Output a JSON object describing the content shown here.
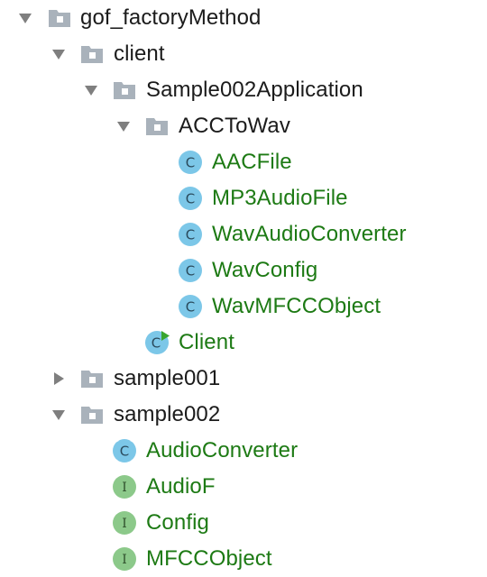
{
  "colors": {
    "folder_text": "#1b1b1b",
    "class_text": "#1d7a14",
    "class_icon": "#7cc7e8",
    "interface_icon": "#8cc98a",
    "folder_icon": "#a9b2bb",
    "arrow": "#7f7f7f",
    "run_badge": "#38a52f"
  },
  "tree": {
    "root": {
      "label": "gof_factoryMethod",
      "icon": "folder-icon",
      "expanded": true
    },
    "client": {
      "label": "client",
      "icon": "folder-icon",
      "expanded": true
    },
    "sample002_application": {
      "label": "Sample002Application",
      "icon": "folder-icon",
      "expanded": true
    },
    "acc_to_wav": {
      "label": "ACCToWav",
      "icon": "folder-icon",
      "expanded": true
    },
    "acc_items": [
      {
        "label": "AACFile",
        "icon": "class-icon",
        "glyph": "C"
      },
      {
        "label": "MP3AudioFile",
        "icon": "class-icon",
        "glyph": "C"
      },
      {
        "label": "WavAudioConverter",
        "icon": "class-icon",
        "glyph": "C"
      },
      {
        "label": "WavConfig",
        "icon": "class-icon",
        "glyph": "C"
      },
      {
        "label": "WavMFCCObject",
        "icon": "class-icon",
        "glyph": "C"
      }
    ],
    "client_class": {
      "label": "Client",
      "icon": "runnable-class-icon",
      "glyph": "C"
    },
    "sample001": {
      "label": "sample001",
      "icon": "folder-icon",
      "expanded": false
    },
    "sample002": {
      "label": "sample002",
      "icon": "folder-icon",
      "expanded": true
    },
    "sample002_items": [
      {
        "label": "AudioConverter",
        "icon": "abstract-class-icon",
        "glyph": "C"
      },
      {
        "label": "AudioF",
        "icon": "interface-icon",
        "glyph": "I"
      },
      {
        "label": "Config",
        "icon": "interface-icon",
        "glyph": "I"
      },
      {
        "label": "MFCCObject",
        "icon": "interface-icon",
        "glyph": "I"
      }
    ]
  }
}
